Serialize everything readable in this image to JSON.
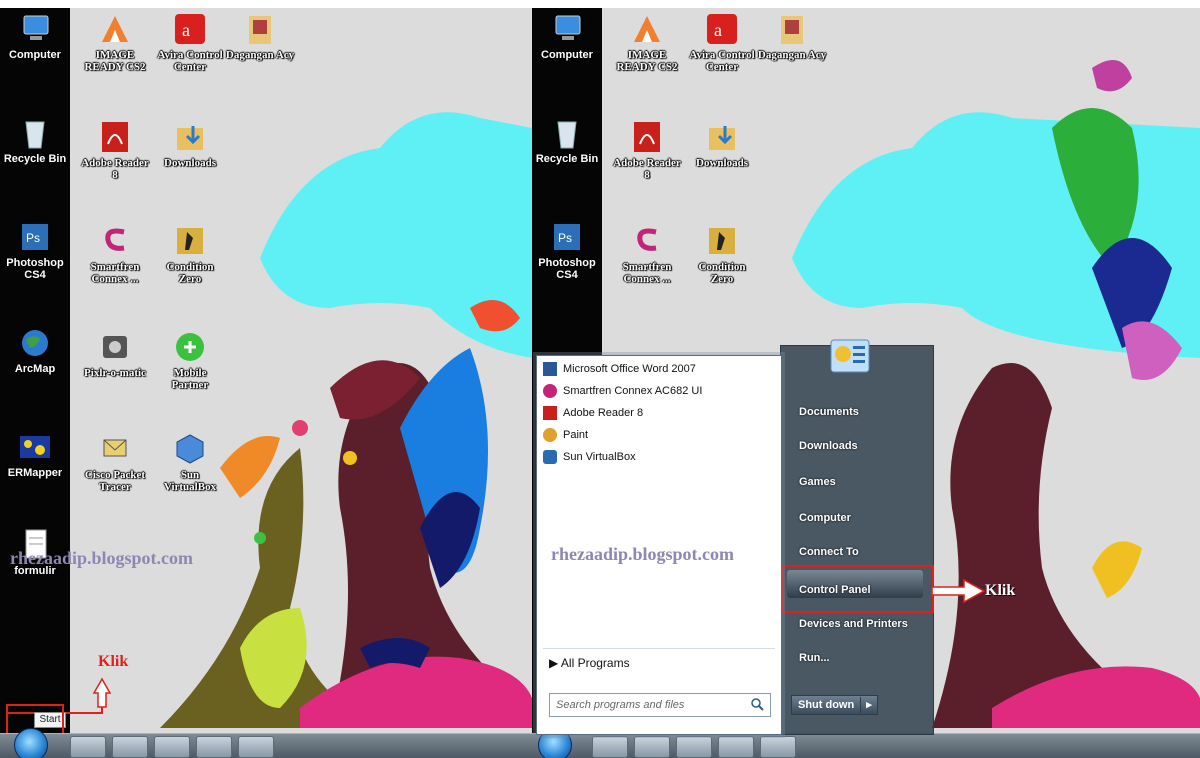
{
  "desktop": {
    "strip_icons": [
      {
        "label": "Computer",
        "icon": "computer-icon"
      },
      {
        "label": "Recycle Bin",
        "icon": "recycle-bin-icon"
      },
      {
        "label": "Photoshop CS4",
        "icon": "photoshop-icon"
      },
      {
        "label": "ArcMap",
        "icon": "arcmap-icon"
      },
      {
        "label": "ERMapper",
        "icon": "ermapper-icon"
      },
      {
        "label": "formulir",
        "icon": "document-icon"
      }
    ],
    "icons": [
      {
        "label": "IMAGE READY CS2",
        "icon": "imageready-icon"
      },
      {
        "label": "Avira Control Center",
        "icon": "avira-icon"
      },
      {
        "label": "Dagangan Acy",
        "icon": "folder-icon"
      },
      {
        "label": "Adobe Reader 8",
        "icon": "pdf-icon"
      },
      {
        "label": "Downloads",
        "icon": "downloads-folder-icon"
      },
      {
        "label": "Smartfren Connex ...",
        "icon": "smartfren-icon"
      },
      {
        "label": "Condition Zero",
        "icon": "condition-zero-icon"
      },
      {
        "label": "Pixlr-o-matic",
        "icon": "pixlr-icon"
      },
      {
        "label": "Mobile Partner",
        "icon": "mobile-partner-icon"
      },
      {
        "label": "Cisco Packet Tracer",
        "icon": "cisco-icon"
      },
      {
        "label": "Sun VirtualBox",
        "icon": "virtualbox-icon"
      }
    ],
    "watermark": "rhezaadip.blogspot.com",
    "klik_left": "Klik",
    "klik_right": "Klik",
    "start_tooltip": "Start"
  },
  "start_menu": {
    "programs": [
      {
        "label": "Microsoft Office Word 2007",
        "icon": "word-icon",
        "color": "#2b5797"
      },
      {
        "label": "Smartfren Connex AC682 UI",
        "icon": "smartfren-icon",
        "color": "#c2247a"
      },
      {
        "label": "Adobe Reader 8",
        "icon": "pdf-icon",
        "color": "#c8201b"
      },
      {
        "label": "Paint",
        "icon": "paint-icon",
        "color": "#e0a030"
      },
      {
        "label": "Sun VirtualBox",
        "icon": "virtualbox-icon",
        "color": "#2a6ab0"
      }
    ],
    "all_programs": "All Programs",
    "search_placeholder": "Search programs and files",
    "right_items": [
      "Documents",
      "Downloads",
      "Games",
      "Computer",
      "Connect To",
      "Control Panel",
      "Devices and Printers",
      "Run..."
    ],
    "shutdown_label": "Shut down"
  },
  "colors": {
    "highlight": "#e0201c",
    "sky": "#5ef0f5",
    "tree": "#5a1f2a"
  }
}
